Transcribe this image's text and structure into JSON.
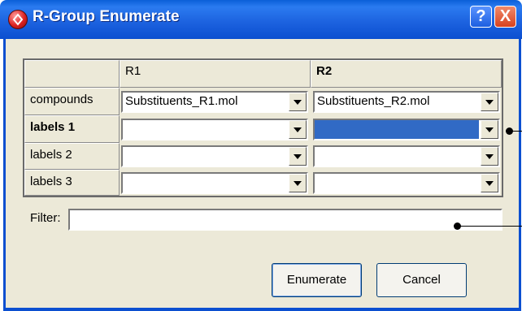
{
  "window": {
    "title": "R-Group Enumerate"
  },
  "titlebar": {
    "help_symbol": "?",
    "close_symbol": "X"
  },
  "grid": {
    "columns": [
      "R1",
      "R2"
    ],
    "rows": [
      {
        "label": "compounds",
        "bold": false,
        "r1": "Substituents_R1.mol",
        "r2": "Substituents_R2.mol"
      },
      {
        "label": "labels 1",
        "bold": true,
        "r1": "",
        "r2": ""
      },
      {
        "label": "labels 2",
        "bold": false,
        "r1": "",
        "r2": ""
      },
      {
        "label": "labels 3",
        "bold": false,
        "r1": "",
        "r2": ""
      }
    ]
  },
  "filter": {
    "label": "Filter:",
    "value": ""
  },
  "buttons": {
    "enumerate": "Enumerate",
    "cancel": "Cancel"
  }
}
